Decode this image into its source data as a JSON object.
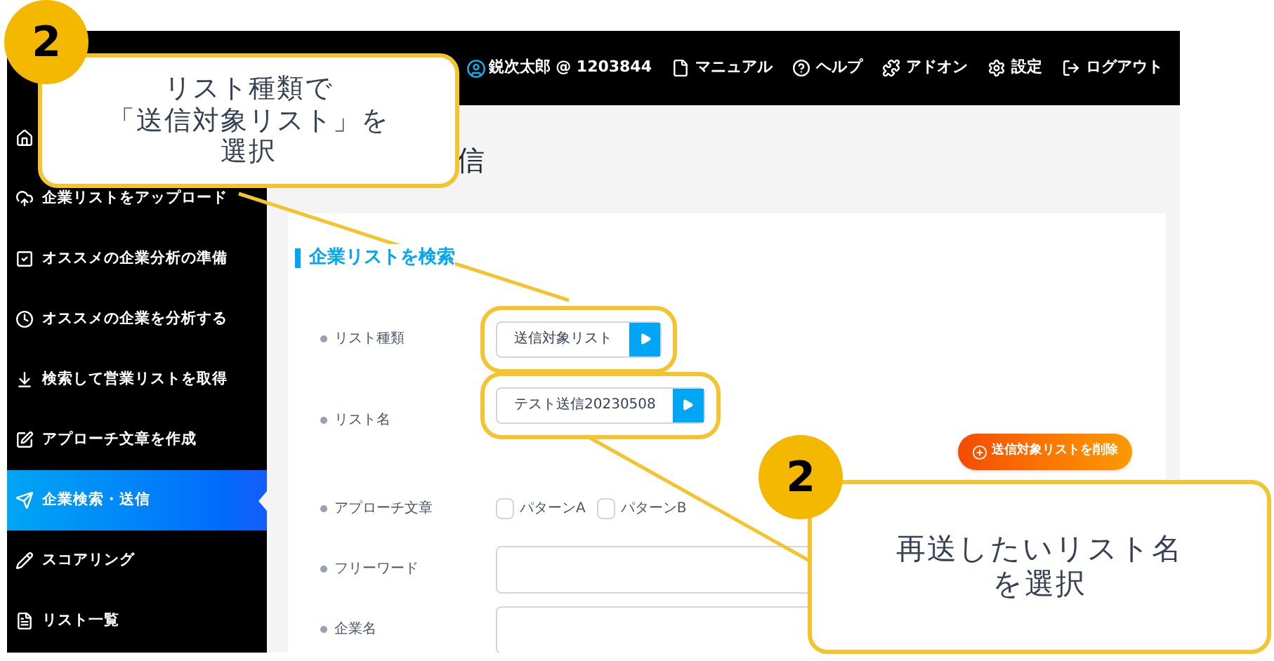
{
  "header": {
    "user": "鋭次太郎 @ 1203844",
    "links": [
      {
        "label": "マニュアル",
        "kind": "document"
      },
      {
        "label": "ヘルプ",
        "kind": "help"
      },
      {
        "label": "アドオン",
        "kind": "addon"
      },
      {
        "label": "設定",
        "kind": "settings"
      },
      {
        "label": "ログアウト",
        "kind": "logout"
      }
    ]
  },
  "sidebar": {
    "items": [
      {
        "kind": "home",
        "selected": false
      },
      {
        "label": "企業リストをアップロード",
        "kind": "upload",
        "selected": false
      },
      {
        "label": "オススメの企業分析の準備",
        "kind": "prepare",
        "selected": false
      },
      {
        "label": "オススメの企業を分析する",
        "kind": "analyze",
        "selected": false
      },
      {
        "label": "検索して営業リストを取得",
        "kind": "fetch",
        "selected": false
      },
      {
        "label": "アプローチ文章を作成",
        "kind": "compose",
        "selected": false
      },
      {
        "label": "企業検索・送信",
        "kind": "send",
        "selected": true
      },
      {
        "label": "スコアリング",
        "kind": "scoring",
        "selected": false
      },
      {
        "label": "リスト一覧",
        "kind": "lists",
        "selected": false
      }
    ]
  },
  "page_title": "信",
  "form": {
    "heading": "企業リストを検索",
    "rows": [
      {
        "kind": "select",
        "label": "リスト種類",
        "value": "送信対象リスト",
        "highlighted": true
      },
      {
        "kind": "select",
        "label": "リスト名",
        "value": "テスト送信20230508",
        "highlighted": true
      },
      {
        "kind": "checks",
        "label": "アプローチ文章",
        "options": [
          {
            "label": "パターンA",
            "checked": false
          },
          {
            "label": "パターンB",
            "checked": false
          }
        ]
      },
      {
        "kind": "text",
        "label": "フリーワード"
      },
      {
        "kind": "text",
        "label": "企業名"
      }
    ],
    "delete_button": "送信対象リストを削除"
  },
  "callouts": [
    {
      "number": "2",
      "lines": [
        "リスト種類で",
        "「送信対象リスト」を",
        "選択"
      ]
    },
    {
      "number": "2",
      "lines": [
        "再送したいリスト名",
        "を選択"
      ]
    }
  ]
}
